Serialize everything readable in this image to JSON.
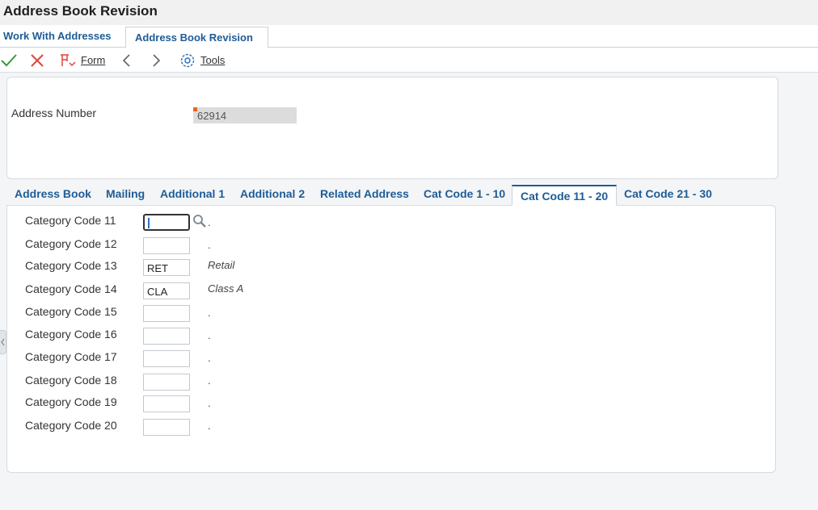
{
  "window": {
    "title": "Address Book Revision"
  },
  "form_tabs": [
    {
      "label": "Work With Addresses"
    },
    {
      "label": "Address Book Revision"
    }
  ],
  "toolbar": {
    "ok_icon": "checkmark-icon",
    "cancel_icon": "x-icon",
    "form_icon": "form-icon",
    "form_label": "Form",
    "prev_icon": "chevron-left-icon",
    "next_icon": "chevron-right-icon",
    "tools_icon": "gear-icon",
    "tools_label": "Tools"
  },
  "header": {
    "address_number_label": "Address Number",
    "address_number_value": "62914"
  },
  "tabs": [
    {
      "label": "Address Book"
    },
    {
      "label": "Mailing"
    },
    {
      "label": "Additional 1"
    },
    {
      "label": "Additional 2"
    },
    {
      "label": "Related Address"
    },
    {
      "label": "Cat Code 1 - 10"
    },
    {
      "label": "Cat Code 11 - 20",
      "active": true
    },
    {
      "label": "Cat Code 21 - 30"
    }
  ],
  "category_codes": [
    {
      "label": "Category Code 11",
      "value": "",
      "description": "."
    },
    {
      "label": "Category Code 12",
      "value": "",
      "description": "."
    },
    {
      "label": "Category Code 13",
      "value": "RET",
      "description": "Retail"
    },
    {
      "label": "Category Code 14",
      "value": "CLA",
      "description": "Class A"
    },
    {
      "label": "Category Code 15",
      "value": "",
      "description": "."
    },
    {
      "label": "Category Code 16",
      "value": "",
      "description": "."
    },
    {
      "label": "Category Code 17",
      "value": "",
      "description": "."
    },
    {
      "label": "Category Code 18",
      "value": "",
      "description": "."
    },
    {
      "label": "Category Code 19",
      "value": "",
      "description": "."
    },
    {
      "label": "Category Code 20",
      "value": "",
      "description": "."
    }
  ],
  "colors": {
    "accent": "#1e5c96",
    "ok": "#3a9a3a",
    "cancel": "#e0443a",
    "required": "#e8671e"
  }
}
